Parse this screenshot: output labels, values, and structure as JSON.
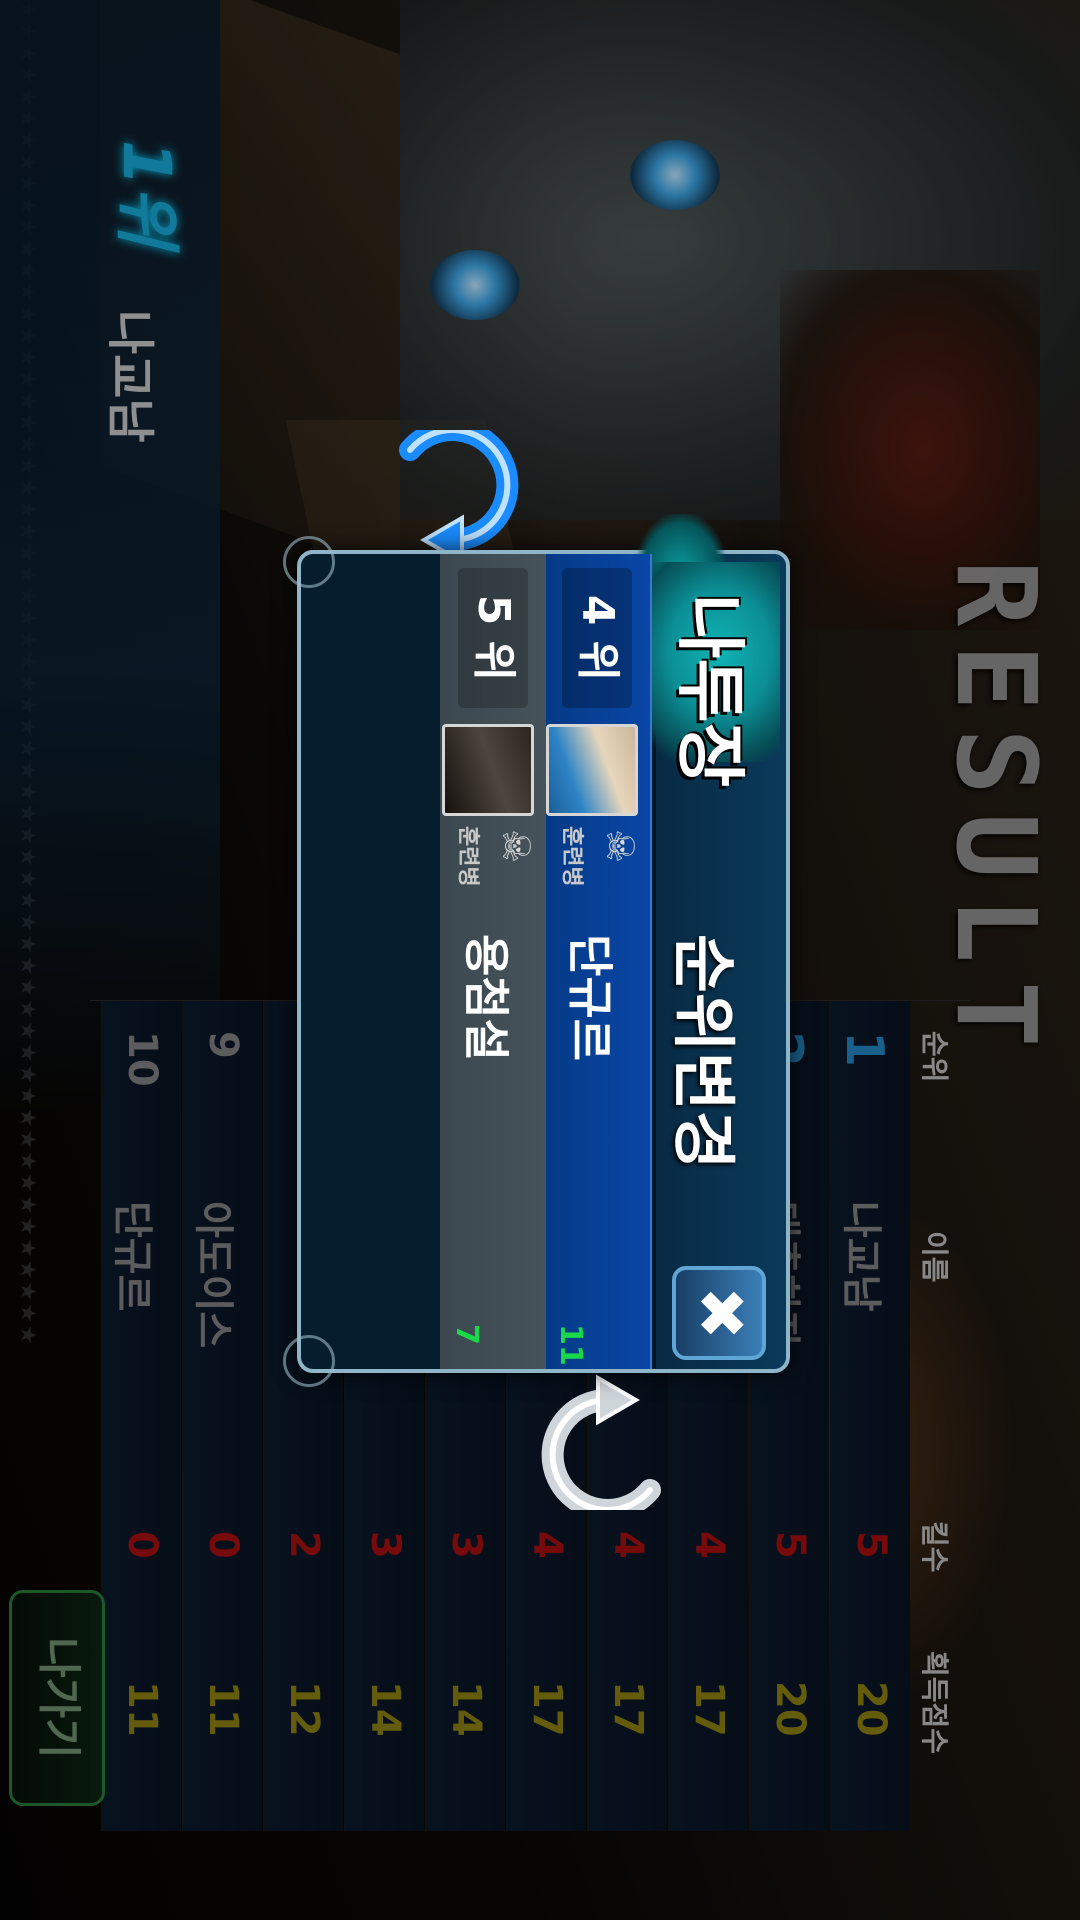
{
  "screen": {
    "title": "RESULT"
  },
  "winner": {
    "place": "1위",
    "name": "나교남"
  },
  "table": {
    "headers": {
      "rank": "순위",
      "name": "이름",
      "kills": "킬수",
      "score": "획득점수"
    },
    "rows": [
      {
        "rank": "1",
        "name": "나교남",
        "kills": "5",
        "score": "20"
      },
      {
        "rank": "2",
        "name": "대충하자",
        "kills": "5",
        "score": "20"
      },
      {
        "rank": "",
        "name": "",
        "kills": "4",
        "score": "17"
      },
      {
        "rank": "",
        "name": "",
        "kills": "4",
        "score": "17"
      },
      {
        "rank": "",
        "name": "",
        "kills": "4",
        "score": "17"
      },
      {
        "rank": "",
        "name": "",
        "kills": "3",
        "score": "14"
      },
      {
        "rank": "",
        "name": "",
        "kills": "3",
        "score": "14"
      },
      {
        "rank": "",
        "name": "",
        "kills": "2",
        "score": "12"
      },
      {
        "rank": "9",
        "name": "아도이스",
        "kills": "0",
        "score": "11"
      },
      {
        "rank": "10",
        "name": "단규르",
        "kills": "0",
        "score": "11"
      }
    ]
  },
  "exit_button": "나가기",
  "popup": {
    "user": "나투장",
    "title": "순위변경",
    "close_icon": "close-x-icon",
    "rows": [
      {
        "rank": "4 위",
        "name": "단규르",
        "class": "훈련병",
        "score": "11"
      },
      {
        "rank": "5 위",
        "name": "용첨설",
        "class": "훈련병",
        "score": "7"
      }
    ]
  },
  "colors": {
    "accent": "#18a9d6",
    "kills": "#a50e0e",
    "score": "#8b7f10",
    "popup_score": "#19d84a",
    "rank_up": "#0a46a6"
  }
}
